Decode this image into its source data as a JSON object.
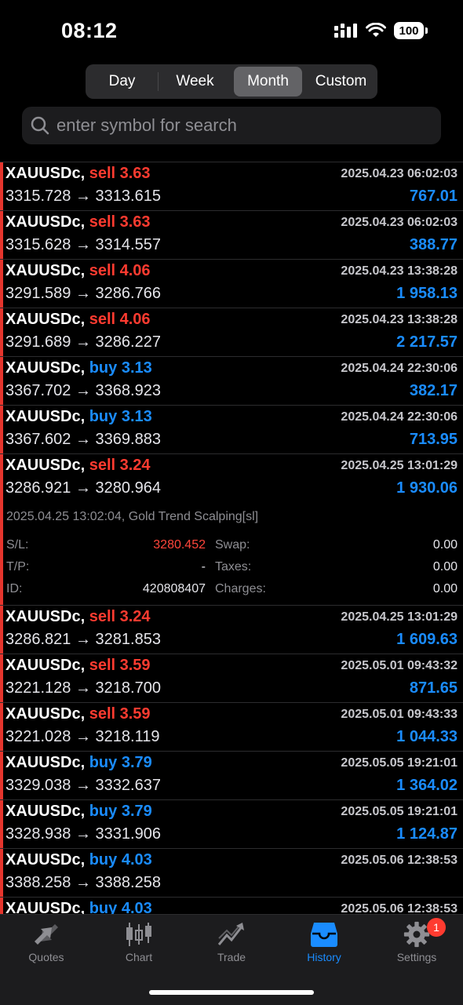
{
  "status": {
    "time": "08:12",
    "battery": "100"
  },
  "period_tabs": [
    "Day",
    "Week",
    "Month",
    "Custom"
  ],
  "active_period": "Month",
  "search": {
    "placeholder": "enter symbol for search"
  },
  "trades": [
    {
      "symbol": "XAUUSDc,",
      "side": "sell",
      "volume": "3.63",
      "open": "3315.728",
      "close": "3313.615",
      "date": "2025.04.23 06:02:03",
      "profit": "767.01"
    },
    {
      "symbol": "XAUUSDc,",
      "side": "sell",
      "volume": "3.63",
      "open": "3315.628",
      "close": "3314.557",
      "date": "2025.04.23 06:02:03",
      "profit": "388.77"
    },
    {
      "symbol": "XAUUSDc,",
      "side": "sell",
      "volume": "4.06",
      "open": "3291.589",
      "close": "3286.766",
      "date": "2025.04.23 13:38:28",
      "profit": "1 958.13"
    },
    {
      "symbol": "XAUUSDc,",
      "side": "sell",
      "volume": "4.06",
      "open": "3291.689",
      "close": "3286.227",
      "date": "2025.04.23 13:38:28",
      "profit": "2 217.57"
    },
    {
      "symbol": "XAUUSDc,",
      "side": "buy",
      "volume": "3.13",
      "open": "3367.702",
      "close": "3368.923",
      "date": "2025.04.24 22:30:06",
      "profit": "382.17"
    },
    {
      "symbol": "XAUUSDc,",
      "side": "buy",
      "volume": "3.13",
      "open": "3367.602",
      "close": "3369.883",
      "date": "2025.04.24 22:30:06",
      "profit": "713.95"
    },
    {
      "symbol": "XAUUSDc,",
      "side": "sell",
      "volume": "3.24",
      "open": "3286.921",
      "close": "3280.964",
      "date": "2025.04.25 13:01:29",
      "profit": "1 930.06",
      "expanded": true,
      "detail": {
        "close_info": "2025.04.25 13:02:04, Gold Trend Scalping[sl]",
        "sl_label": "S/L:",
        "sl": "3280.452",
        "tp_label": "T/P:",
        "tp": "-",
        "id_label": "ID:",
        "id": "420808407",
        "swap_label": "Swap:",
        "swap": "0.00",
        "taxes_label": "Taxes:",
        "taxes": "0.00",
        "charges_label": "Charges:",
        "charges": "0.00"
      }
    },
    {
      "symbol": "XAUUSDc,",
      "side": "sell",
      "volume": "3.24",
      "open": "3286.821",
      "close": "3281.853",
      "date": "2025.04.25 13:01:29",
      "profit": "1 609.63"
    },
    {
      "symbol": "XAUUSDc,",
      "side": "sell",
      "volume": "3.59",
      "open": "3221.128",
      "close": "3218.700",
      "date": "2025.05.01 09:43:32",
      "profit": "871.65"
    },
    {
      "symbol": "XAUUSDc,",
      "side": "sell",
      "volume": "3.59",
      "open": "3221.028",
      "close": "3218.119",
      "date": "2025.05.01 09:43:33",
      "profit": "1 044.33"
    },
    {
      "symbol": "XAUUSDc,",
      "side": "buy",
      "volume": "3.79",
      "open": "3329.038",
      "close": "3332.637",
      "date": "2025.05.05 19:21:01",
      "profit": "1 364.02"
    },
    {
      "symbol": "XAUUSDc,",
      "side": "buy",
      "volume": "3.79",
      "open": "3328.938",
      "close": "3331.906",
      "date": "2025.05.05 19:21:01",
      "profit": "1 124.87"
    },
    {
      "symbol": "XAUUSDc,",
      "side": "buy",
      "volume": "4.03",
      "open": "3388.258",
      "close": "3388.258",
      "date": "2025.05.06 12:38:53",
      "profit": ""
    },
    {
      "symbol": "XAUUSDc,",
      "side": "buy",
      "volume": "4.03",
      "open": "",
      "close": "",
      "date": "2025.05.06 12:38:53",
      "profit": ""
    }
  ],
  "arrow": "→",
  "tabbar": {
    "items": [
      {
        "label": "Quotes",
        "icon": "quotes-icon"
      },
      {
        "label": "Chart",
        "icon": "chart-icon"
      },
      {
        "label": "Trade",
        "icon": "trade-icon"
      },
      {
        "label": "History",
        "icon": "history-icon"
      },
      {
        "label": "Settings",
        "icon": "settings-icon"
      }
    ],
    "active": "History",
    "settings_badge": "1"
  },
  "colors": {
    "sell": "#ff3b30",
    "buy": "#1a8cff",
    "profit": "#1a8cff",
    "accent": "#1a8cff",
    "row_marker": "#e5352d"
  }
}
